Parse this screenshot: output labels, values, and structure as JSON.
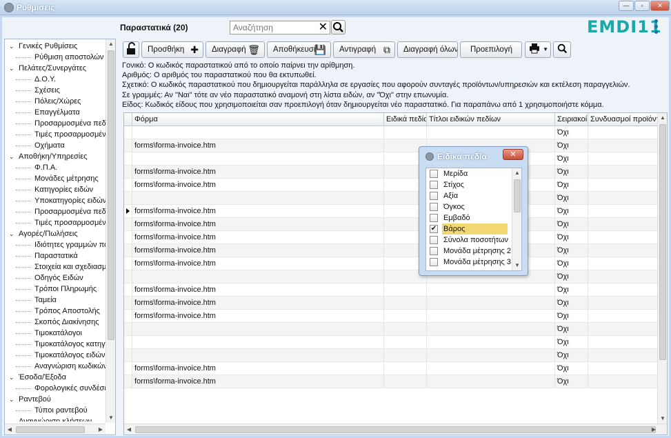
{
  "window": {
    "title": "Ρυθμίσεις",
    "minimize": "—",
    "restore": "▫",
    "close": "✕"
  },
  "brand": {
    "logo_text": "EMDI11",
    "accent": "#1aa9a9"
  },
  "header": {
    "section_title": "Παραστατικά (20)",
    "search_placeholder": "Αναζήτηση",
    "search_value": ""
  },
  "sidebar": {
    "items": [
      {
        "label": "Γενικές Ρυθμίσεις",
        "level": 0
      },
      {
        "label": "Ρύθμιση αποστολών",
        "level": 1
      },
      {
        "label": "Πελάτες/Συνεργάτες",
        "level": 0
      },
      {
        "label": "Δ.Ο.Υ.",
        "level": 1
      },
      {
        "label": "Σχέσεις",
        "level": 1
      },
      {
        "label": "Πόλεις/Χώρες",
        "level": 1
      },
      {
        "label": "Επαγγέλματα",
        "level": 1
      },
      {
        "label": "Προσαρμοσμένα πεδία",
        "level": 1
      },
      {
        "label": "Τιμές προσαρμοσμένων",
        "level": 1
      },
      {
        "label": "Οχήματα",
        "level": 1
      },
      {
        "label": "Αποθήκη/Υπηρεσίες",
        "level": 0
      },
      {
        "label": "Φ.Π.Α.",
        "level": 1
      },
      {
        "label": "Μονάδες μέτρησης",
        "level": 1
      },
      {
        "label": "Κατηγορίες ειδών",
        "level": 1
      },
      {
        "label": "Υποκατηγορίες ειδών",
        "level": 1
      },
      {
        "label": "Προσαρμοσμένα πεδία",
        "level": 1
      },
      {
        "label": "Τιμές προσαρμοσμένων",
        "level": 1
      },
      {
        "label": "Αγορές/Πωλήσεις",
        "level": 0
      },
      {
        "label": "Ιδιότητες γραμμών παρ",
        "level": 1
      },
      {
        "label": "Παραστατικά",
        "level": 1
      },
      {
        "label": "Στοιχεία και σχεδιασμός",
        "level": 1
      },
      {
        "label": "Οδηγός Ειδών",
        "level": 1
      },
      {
        "label": "Τρόποι Πληρωμής",
        "level": 1
      },
      {
        "label": "Ταμεία",
        "level": 1
      },
      {
        "label": "Τρόπος Αποστολής",
        "level": 1
      },
      {
        "label": "Σκοπός Διακίνησης",
        "level": 1
      },
      {
        "label": "Τιμοκατάλογοι",
        "level": 1
      },
      {
        "label": "Τιμοκατάλογος κατηγορ",
        "level": 1
      },
      {
        "label": "Τιμοκατάλογος ειδών",
        "level": 1
      },
      {
        "label": "Αναγνώριση κωδικών",
        "level": 1
      },
      {
        "label": "Έσοδα/Έξοδα",
        "level": 0
      },
      {
        "label": "Φορολογικές συνδέσεις",
        "level": 1
      },
      {
        "label": "Ραντεβού",
        "level": 0
      },
      {
        "label": "Τύποι ραντεβού",
        "level": 1
      },
      {
        "label": "Αναγνώριση κλήσεων",
        "level": 0
      }
    ]
  },
  "toolbar": {
    "add": "Προσθήκη",
    "delete": "Διαγραφή",
    "save": "Αποθήκευση",
    "copy": "Αντιγραφή",
    "delete_all": "Διαγραφή όλων",
    "default": "Προεπιλογή"
  },
  "description": [
    "Γονικό: Ο κωδικός παραστατικού από το οποίο παίρνει την αρίθμηση.",
    "Αριθμός: Ο αριθμός του παραστατικού που θα εκτυπωθεί.",
    "Σχετικό: Ο κωδικός παραστατικού που δημιουργείται παράλληλα σε εργασίες που αφορούν συνταγές προϊόντων/υπηρεσιών και εκτέλεση παραγγελιών.",
    "Σε γραμμές: Αν \"Ναι\" τότε αν νέο παραστατικό αναμονή στη λίστα ειδών, αν \"Όχι\" στην επωνυμία.",
    "Είδος: Κωδικός είδους που χρησιμοποιείται σαν προεπιλογή όταν δημιουργείται νέο παραστατικό. Για παραπάνω από 1 χρησιμοποιήστε κόμμα."
  ],
  "grid": {
    "columns": [
      "Φόρμα",
      "Ειδικά πεδία",
      "Τίτλοι ειδικών πεδίων",
      "Σειριακοί",
      "Συνδυασμοί προϊόντ"
    ],
    "rows": [
      {
        "form": "",
        "serial": "Όχι"
      },
      {
        "form": "forms\\forma-invoice.htm",
        "serial": "Όχι"
      },
      {
        "form": "",
        "serial": "Όχι"
      },
      {
        "form": "forms\\forma-invoice.htm",
        "serial": "Όχι"
      },
      {
        "form": "forms\\forma-invoice.htm",
        "serial": "Όχι"
      },
      {
        "form": "",
        "serial": "Όχι"
      },
      {
        "form": "forms\\forma-invoice.htm",
        "serial": "Όχι",
        "selected": true
      },
      {
        "form": "forms\\forma-invoice.htm",
        "serial": "Όχι"
      },
      {
        "form": "forms\\forma-invoice.htm",
        "serial": "Όχι"
      },
      {
        "form": "forms\\forma-invoice.htm",
        "serial": "Όχι"
      },
      {
        "form": "forms\\forma-invoice.htm",
        "serial": "Όχι"
      },
      {
        "form": "",
        "serial": "Όχι"
      },
      {
        "form": "forms\\forma-invoice.htm",
        "serial": "Όχι"
      },
      {
        "form": "forms\\forma-invoice.htm",
        "serial": "Όχι"
      },
      {
        "form": "forms\\forma-invoice.htm",
        "serial": "Όχι"
      },
      {
        "form": "",
        "serial": "Όχι"
      },
      {
        "form": "",
        "serial": "Όχι"
      },
      {
        "form": "",
        "serial": "Όχι"
      },
      {
        "form": "forms\\forma-invoice.htm",
        "serial": "Όχι"
      },
      {
        "form": "forms\\forma-invoice.htm",
        "serial": "Όχι"
      }
    ]
  },
  "popup": {
    "title": "Ειδικά πεδία",
    "close": "✕",
    "options": [
      {
        "label": "Μερίδα",
        "checked": false
      },
      {
        "label": "Στίχος",
        "checked": false
      },
      {
        "label": "Αξία",
        "checked": false
      },
      {
        "label": "Όγκος",
        "checked": false
      },
      {
        "label": "Εμβαδό",
        "checked": false
      },
      {
        "label": "Βάρος",
        "checked": true
      },
      {
        "label": "Σύνολα ποσοτήτων",
        "checked": false
      },
      {
        "label": "Μονάδα μέτρησης 2",
        "checked": false
      },
      {
        "label": "Μονάδα μέτρησης 3",
        "checked": false
      }
    ]
  }
}
